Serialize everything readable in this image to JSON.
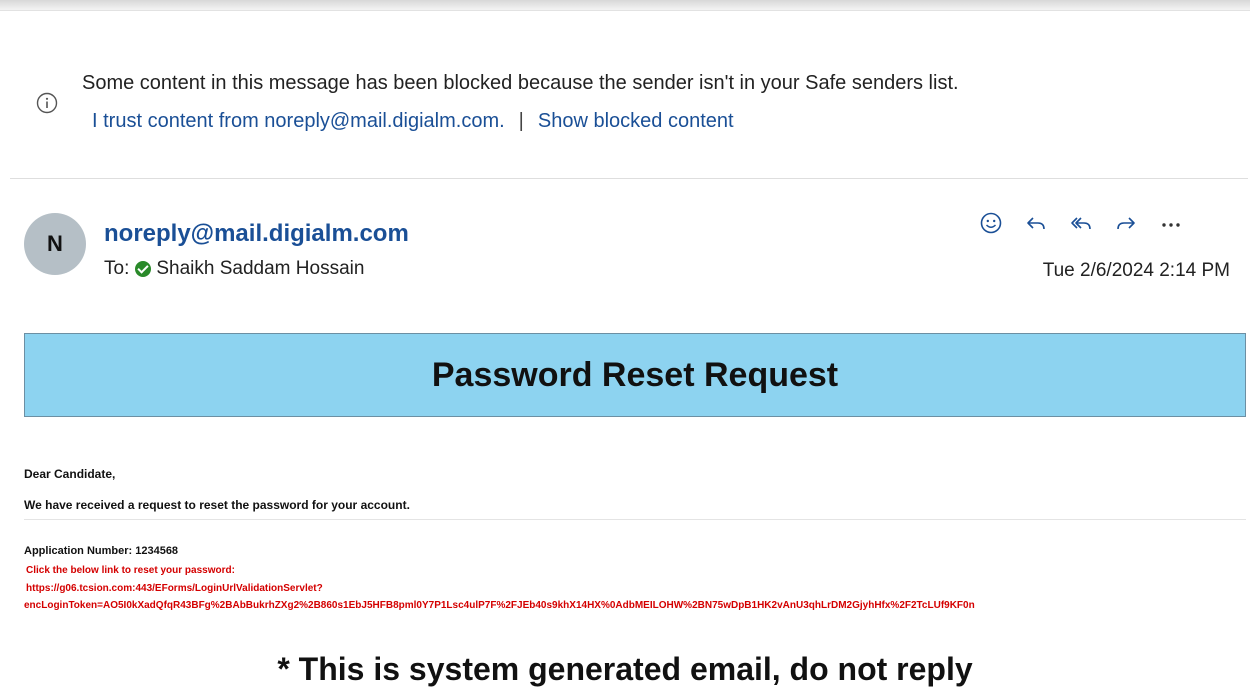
{
  "notice": {
    "icon": "info-icon",
    "message": "Some content in this message has been blocked because the sender isn't in your Safe senders list.",
    "trust_link": "I trust content from noreply@mail.digialm.com.",
    "separator": "|",
    "show_link": "Show blocked content"
  },
  "header": {
    "avatar_initial": "N",
    "sender": "noreply@mail.digialm.com",
    "to_label": "To:",
    "recipient": "Shaikh Saddam Hossain",
    "date": "Tue 2/6/2024 2:14 PM",
    "actions": [
      {
        "icon": "emoji-icon"
      },
      {
        "icon": "reply-icon"
      },
      {
        "icon": "reply-all-icon"
      },
      {
        "icon": "forward-icon"
      },
      {
        "icon": "more-icon"
      }
    ]
  },
  "body": {
    "banner_title": "Password Reset Request",
    "greeting": "Dear Candidate,",
    "intro": "We have received a request to reset the password for your account.",
    "application_number": "Application Number: 1234568",
    "link_instruction": "Click the below link to reset your password:",
    "link_line1": "https://g06.tcsion.com:443/EForms/LoginUrlValidationServlet?",
    "link_line2": "encLoginToken=AO5I0kXadQfqR43BFg%2BAbBukrhZXg2%2B860s1EbJ5HFB8pml0Y7P1Lsc4ulP7F%2FJEb40s9khX14HX%0AdbMEILOHW%2BN75wDpB1HK2vAnU3qhLrDM2GjyhHfx%2F2TcLUf9KF0n",
    "footer": "* This is system generated email, do not reply"
  },
  "colors": {
    "banner": "#8dd3f0",
    "link": "#1a4f96",
    "alert_red": "#d40000",
    "verified_green": "#2a8a2a"
  }
}
